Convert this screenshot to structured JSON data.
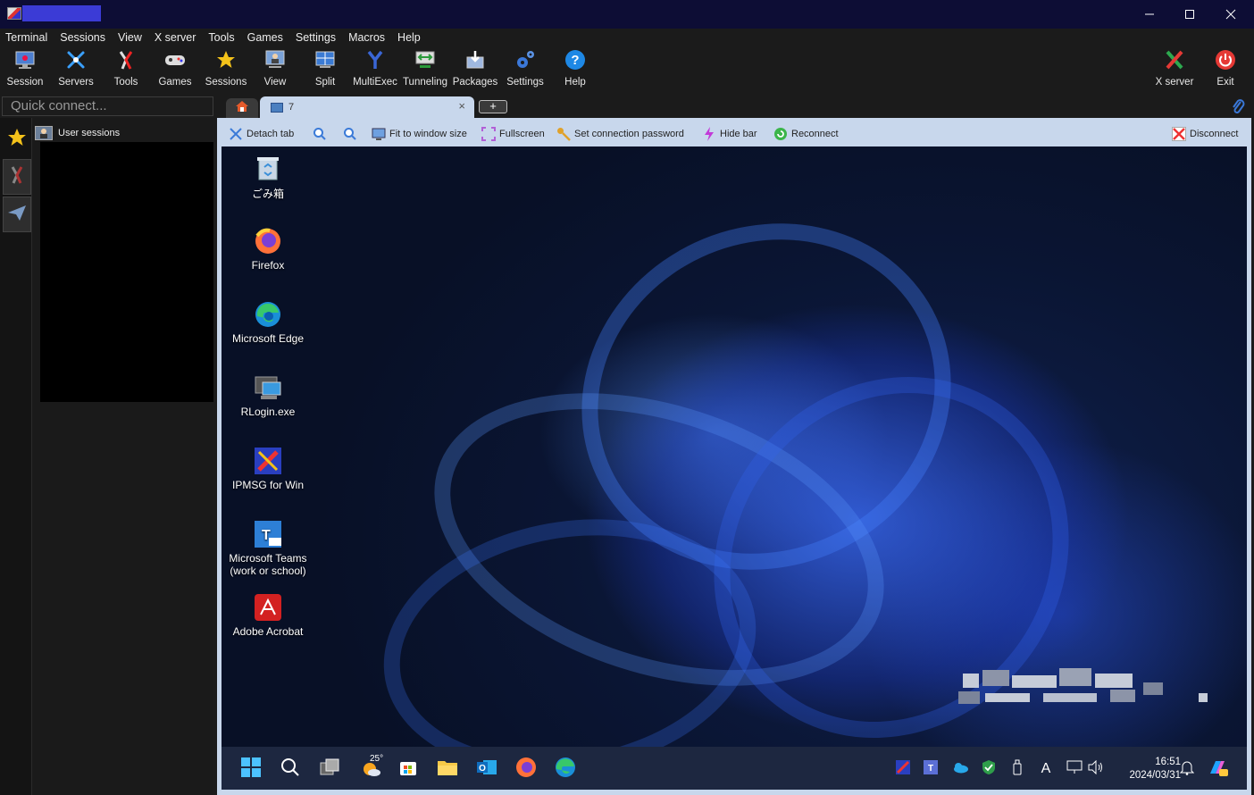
{
  "menu": [
    "Terminal",
    "Sessions",
    "View",
    "X server",
    "Tools",
    "Games",
    "Settings",
    "Macros",
    "Help"
  ],
  "toolbar": {
    "session": "Session",
    "servers": "Servers",
    "tools": "Tools",
    "games": "Games",
    "sessions": "Sessions",
    "view": "View",
    "split": "Split",
    "multiexec": "MultiExec",
    "tunneling": "Tunneling",
    "packages": "Packages",
    "settings": "Settings",
    "help": "Help",
    "xserver": "X server",
    "exit": "Exit"
  },
  "quick_connect": {
    "placeholder": "Quick connect..."
  },
  "sessions_panel": {
    "header": "User sessions"
  },
  "tabs": {
    "active_label": "7",
    "close": "×",
    "add": "+"
  },
  "rdp_toolbar": {
    "detach": "Detach tab",
    "fit": "Fit to window size",
    "fullscreen": "Fullscreen",
    "password": "Set connection password",
    "hidebar": "Hide bar",
    "reconnect": "Reconnect",
    "disconnect": "Disconnect"
  },
  "desktop_icons": {
    "recycle": "ごみ箱",
    "firefox": "Firefox",
    "edge": "Microsoft Edge",
    "rlogin": "RLogin.exe",
    "ipmsg": "IPMSG for Win",
    "teams_line1": "Microsoft Teams",
    "teams_line2": "(work or school)",
    "acrobat": "Adobe Acrobat"
  },
  "taskbar": {
    "weather_temp": "25°",
    "time": "16:51",
    "date": "2024/03/31",
    "ime": "A"
  },
  "colors": {
    "titlebar": "#0d0d35",
    "app_bg": "#1b1b1b",
    "frame": "#c8d7ec",
    "taskbar": "#1d2740"
  }
}
